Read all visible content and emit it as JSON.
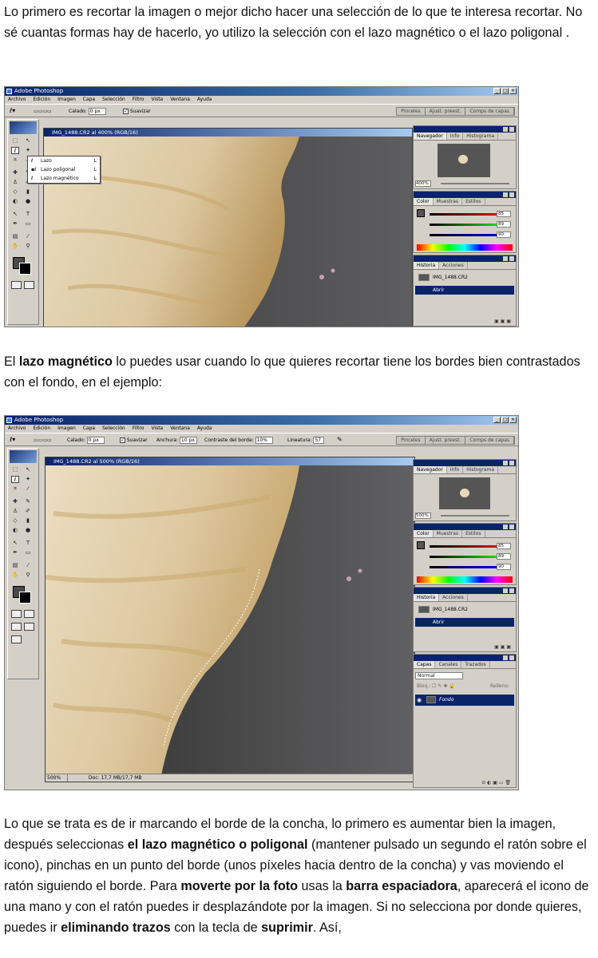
{
  "paragraph_1": {
    "text": "Lo primero es recortar la imagen o mejor dicho hacer una selección de lo que te interesa recortar. No sé cuantas formas hay de hacerlo, yo utilizo la selección con el lazo magnético o el lazo poligonal ."
  },
  "paragraph_2": {
    "pre": "El ",
    "bold": "lazo magnético",
    "post": " lo puedes usar cuando lo que quieres recortar tiene los bordes bien contrastados con el fondo, en el ejemplo:"
  },
  "paragraph_3": {
    "t1": "Lo que se trata es de ir marcando el borde de la concha, lo primero es aumentar bien la imagen, después seleccionas ",
    "b1": "el lazo magnético o poligonal",
    "t2": " (mantener pulsado un segundo el ratón sobre el icono), pinchas en un punto del borde (unos píxeles hacia dentro de la concha) y vas moviendo el ratón siguiendo el borde. Para ",
    "b2": "moverte por la foto",
    "t3": " usas la ",
    "b3": "barra espaciadora",
    "t4": ", aparecerá el icono de una mano y con el ratón puedes ir desplazándote por la imagen. Si no selecciona por donde quieres, puedes ir ",
    "b4": "eliminando trazos",
    "t5": " con la tecla de ",
    "b5": "suprimir",
    "t6": ". Así,"
  },
  "screenshot_1": {
    "app_title": "Adobe Photoshop",
    "menu": [
      "Archivo",
      "Edición",
      "Imagen",
      "Capa",
      "Selección",
      "Filtro",
      "Vista",
      "Ventana",
      "Ayuda"
    ],
    "options": {
      "feather_label": "Calado:",
      "feather_value": "0 px",
      "smooth_label": "Suavizar"
    },
    "panel_tabs": [
      "Pinceles",
      "Ajust. preest.",
      "Comps de capas"
    ],
    "doc_title": "IMG_1488.CR2 al 400% (RGB/16)",
    "flyout": [
      {
        "label": "Lazo",
        "key": "L"
      },
      {
        "label": "Lazo poligonal",
        "key": "L"
      },
      {
        "label": "Lazo magnético",
        "key": "L"
      }
    ],
    "navigator": {
      "tabs": [
        "Navegador",
        "Info",
        "Histograma"
      ],
      "zoom": "400%"
    },
    "color": {
      "tabs": [
        "Color",
        "Muestras",
        "Estilos"
      ],
      "r": "85",
      "g": "89",
      "b": "90"
    },
    "history": {
      "tabs": [
        "Historia",
        "Acciones"
      ],
      "snapshot": "IMG_1488.CR2",
      "step": "Abrir"
    }
  },
  "screenshot_2": {
    "app_title": "Adobe Photoshop",
    "menu": [
      "Archivo",
      "Edición",
      "Imagen",
      "Capa",
      "Selección",
      "Filtro",
      "Vista",
      "Ventana",
      "Ayuda"
    ],
    "options": {
      "feather_label": "Calado:",
      "feather_value": "0 px",
      "smooth_label": "Suavizar",
      "width_label": "Anchura:",
      "width_value": "10 px",
      "contrast_label": "Contraste del borde:",
      "contrast_value": "10%",
      "freq_label": "Lineatura:",
      "freq_value": "57"
    },
    "panel_tabs": [
      "Pinceles",
      "Ajust. preest.",
      "Comps de capas"
    ],
    "doc_title": "IMG_1488.CR2 al 500% (RGB/16)",
    "navigator": {
      "tabs": [
        "Navegador",
        "Info",
        "Histograma"
      ],
      "zoom": "500%"
    },
    "color": {
      "tabs": [
        "Color",
        "Muestras",
        "Estilos"
      ],
      "r": "85",
      "g": "89",
      "b": "90"
    },
    "history": {
      "tabs": [
        "Historia",
        "Acciones"
      ],
      "snapshot": "IMG_1488.CR2",
      "step": "Abrir"
    },
    "layers": {
      "tabs": [
        "Capas",
        "Canales",
        "Trazados"
      ],
      "mode": "Normal",
      "lock_label": "Bloq.:",
      "fill_label": "Relleno:",
      "layer_name": "Fondo"
    },
    "status": {
      "zoom": "500%",
      "doc": "Doc: 17,7 MB/17,7 MB"
    }
  },
  "colors": {
    "title_bar": "#0a246a",
    "chrome": "#d4d0c8",
    "shell": "#e8d8b8",
    "background": "#4a4a4a"
  }
}
